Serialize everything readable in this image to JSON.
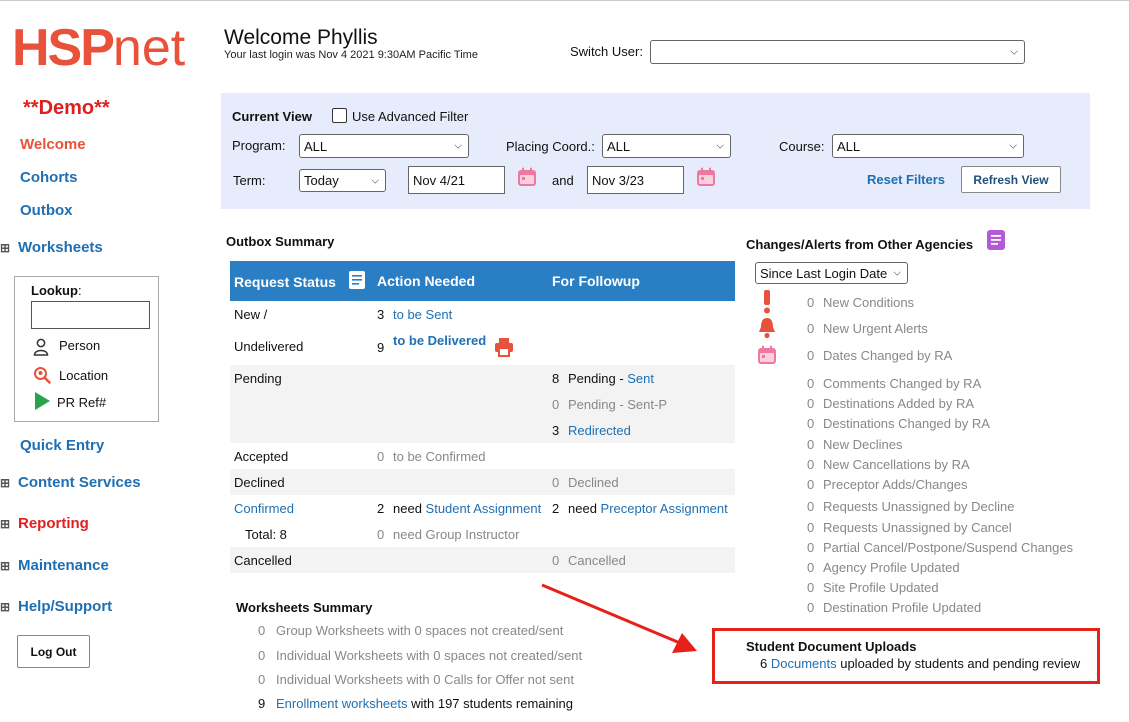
{
  "sidebar": {
    "logo_hsp": "HSP",
    "logo_net": "net",
    "demo": "**Demo**",
    "welcome": "Welcome",
    "cohorts": "Cohorts",
    "outbox": "Outbox",
    "worksheets": "Worksheets",
    "lookup_label": "Lookup",
    "lookup_colon": ":",
    "lookup_person": "Person",
    "lookup_location": "Location",
    "lookup_pr_ref": "PR Ref#",
    "quick_entry": "Quick Entry",
    "content_services": "Content Services",
    "reporting": "Reporting",
    "maintenance": "Maintenance",
    "help_support": "Help/Support",
    "log_out": "Log Out",
    "expand_glyph": "⊞"
  },
  "header": {
    "title": "Welcome Phyllis",
    "last_login": "Your last login was Nov 4 2021 9:30AM Pacific Time",
    "switch_user_label": "Switch User:",
    "switch_user_value": ""
  },
  "filters": {
    "current_view": "Current View",
    "advanced_filter": "Use Advanced Filter",
    "program_label": "Program:",
    "program_value": "ALL",
    "placing_label": "Placing Coord.:",
    "placing_value": "ALL",
    "course_label": "Course:",
    "course_value": "ALL",
    "term_label": "Term:",
    "term_value": "Today",
    "date_from": "Nov 4/21",
    "and": "and",
    "date_to": "Nov 3/23",
    "reset": "Reset Filters",
    "refresh": "Refresh View"
  },
  "outbox": {
    "title": "Outbox Summary",
    "col_status": "Request Status",
    "col_action": "Action Needed",
    "col_followup": "For Followup",
    "new_label": "New /",
    "undelivered_label": "Undelivered",
    "new_count": "3",
    "new_action": "to be Sent",
    "undelivered_count": "9",
    "undelivered_action": "to be Delivered",
    "pending_label": "Pending",
    "pending_sent_count": "8",
    "pending_sent_prefix": "Pending - ",
    "pending_sent_link": "Sent",
    "pending_sentp_count": "0",
    "pending_sentp": "Pending - Sent-P",
    "redirected_count": "3",
    "redirected": "Redirected",
    "accepted_label": "Accepted",
    "accepted_count": "0",
    "accepted_action": "to be Confirmed",
    "declined_label": "Declined",
    "declined_count": "0",
    "declined_text": "Declined",
    "confirmed_label": "Confirmed",
    "confirmed_action_count": "2",
    "need": "need",
    "confirmed_action_link": "Student Assignment",
    "confirmed_follow_count": "2",
    "confirmed_follow_link": "Preceptor Assignment",
    "total": "Total: 8",
    "group_instr_count": "0",
    "group_instr": "need Group Instructor",
    "cancelled_label": "Cancelled",
    "cancelled_count": "0",
    "cancelled_text": "Cancelled",
    "slash": "/"
  },
  "worksheets": {
    "title": "Worksheets Summary",
    "rows": [
      {
        "count": "0",
        "text": "Group Worksheets with 0 spaces not created/sent"
      },
      {
        "count": "0",
        "text": "Individual Worksheets with 0 spaces not created/sent"
      },
      {
        "count": "0",
        "text": "Individual Worksheets with 0 Calls for Offer not sent"
      }
    ],
    "enroll_count": "9",
    "enroll_link": "Enrollment worksheets",
    "enroll_rest": " with 197 students remaining"
  },
  "alerts": {
    "title": "Changes/Alerts from Other Agencies",
    "since": "Since Last Login Date",
    "items": [
      {
        "count": "0",
        "text": "New Conditions"
      },
      {
        "count": "0",
        "text": "New Urgent Alerts"
      },
      {
        "count": "0",
        "text": "Dates Changed by RA"
      },
      {
        "count": "0",
        "text": "Comments Changed by RA"
      },
      {
        "count": "0",
        "text": "Destinations Added by RA"
      },
      {
        "count": "0",
        "text": "Destinations Changed by RA"
      },
      {
        "count": "0",
        "text": "New Declines"
      },
      {
        "count": "0",
        "text": "New Cancellations by RA"
      },
      {
        "count": "0",
        "text": "Preceptor Adds/Changes"
      },
      {
        "count": "0",
        "text": "Requests Unassigned by Decline"
      },
      {
        "count": "0",
        "text": "Requests Unassigned by Cancel"
      },
      {
        "count": "0",
        "text": "Partial Cancel/Postpone/Suspend Changes"
      },
      {
        "count": "0",
        "text": "Agency Profile Updated"
      },
      {
        "count": "0",
        "text": "Site Profile Updated"
      },
      {
        "count": "0",
        "text": "Destination Profile Updated"
      }
    ]
  },
  "uploads": {
    "title": "Student Document Uploads",
    "count": "6",
    "link": "Documents",
    "rest": " uploaded by students and pending review"
  },
  "colors": {
    "brand": "#e8523a",
    "link": "#1f6fb2",
    "table_header": "#2a7ec4",
    "filter_bg": "#e6ecfb",
    "highlight": "#e5211a"
  }
}
